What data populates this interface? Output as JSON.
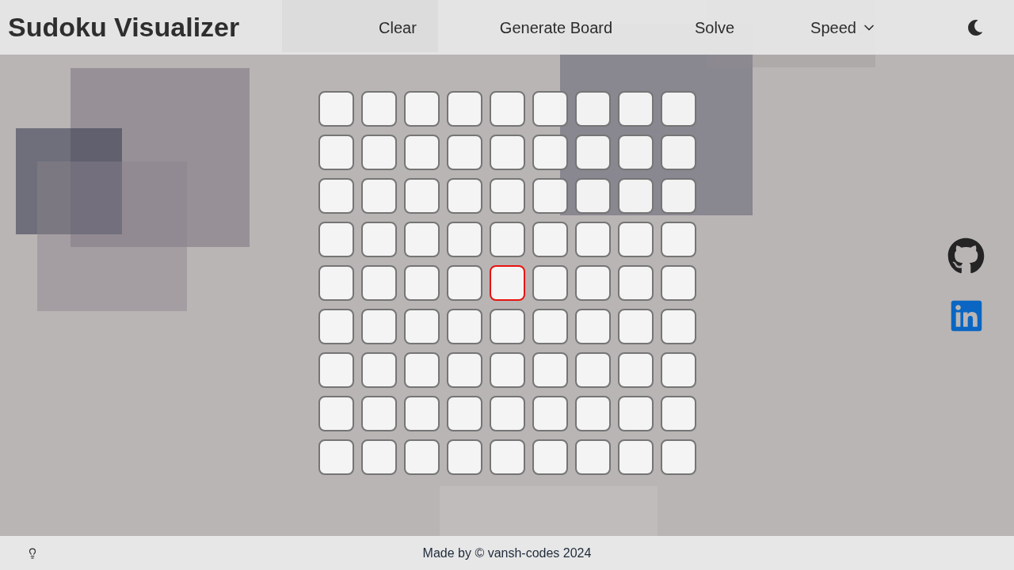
{
  "header": {
    "title": "Sudoku Visualizer",
    "nav": [
      {
        "kind": "button",
        "label": "Clear"
      },
      {
        "kind": "button",
        "label": "Generate Board"
      },
      {
        "kind": "button",
        "label": "Solve"
      },
      {
        "kind": "dropdown",
        "label": "Speed"
      }
    ]
  },
  "board": {
    "cells": [
      [
        {
          "selected": false
        },
        {
          "selected": false
        },
        {
          "selected": false
        },
        {
          "selected": false
        },
        {
          "selected": false
        },
        {
          "selected": false
        },
        {
          "selected": false
        },
        {
          "selected": false
        },
        {
          "selected": false
        }
      ],
      [
        {
          "selected": false
        },
        {
          "selected": false
        },
        {
          "selected": false
        },
        {
          "selected": false
        },
        {
          "selected": false
        },
        {
          "selected": false
        },
        {
          "selected": false
        },
        {
          "selected": false
        },
        {
          "selected": false
        }
      ],
      [
        {
          "selected": false
        },
        {
          "selected": false
        },
        {
          "selected": false
        },
        {
          "selected": false
        },
        {
          "selected": false
        },
        {
          "selected": false
        },
        {
          "selected": false
        },
        {
          "selected": false
        },
        {
          "selected": false
        }
      ],
      [
        {
          "selected": false
        },
        {
          "selected": false
        },
        {
          "selected": false
        },
        {
          "selected": false
        },
        {
          "selected": false
        },
        {
          "selected": false
        },
        {
          "selected": false
        },
        {
          "selected": false
        },
        {
          "selected": false
        }
      ],
      [
        {
          "selected": false
        },
        {
          "selected": false
        },
        {
          "selected": false
        },
        {
          "selected": false
        },
        {
          "selected": true
        },
        {
          "selected": false
        },
        {
          "selected": false
        },
        {
          "selected": false
        },
        {
          "selected": false
        }
      ],
      [
        {
          "selected": false
        },
        {
          "selected": false
        },
        {
          "selected": false
        },
        {
          "selected": false
        },
        {
          "selected": false
        },
        {
          "selected": false
        },
        {
          "selected": false
        },
        {
          "selected": false
        },
        {
          "selected": false
        }
      ],
      [
        {
          "selected": false
        },
        {
          "selected": false
        },
        {
          "selected": false
        },
        {
          "selected": false
        },
        {
          "selected": false
        },
        {
          "selected": false
        },
        {
          "selected": false
        },
        {
          "selected": false
        },
        {
          "selected": false
        }
      ],
      [
        {
          "selected": false
        },
        {
          "selected": false
        },
        {
          "selected": false
        },
        {
          "selected": false
        },
        {
          "selected": false
        },
        {
          "selected": false
        },
        {
          "selected": false
        },
        {
          "selected": false
        },
        {
          "selected": false
        }
      ],
      [
        {
          "selected": false
        },
        {
          "selected": false
        },
        {
          "selected": false
        },
        {
          "selected": false
        },
        {
          "selected": false
        },
        {
          "selected": false
        },
        {
          "selected": false
        },
        {
          "selected": false
        },
        {
          "selected": false
        }
      ]
    ]
  },
  "social_links": [
    {
      "kind": "github"
    },
    {
      "kind": "linkedin"
    }
  ],
  "footer": {
    "text": "Made by © vansh-codes 2024"
  }
}
